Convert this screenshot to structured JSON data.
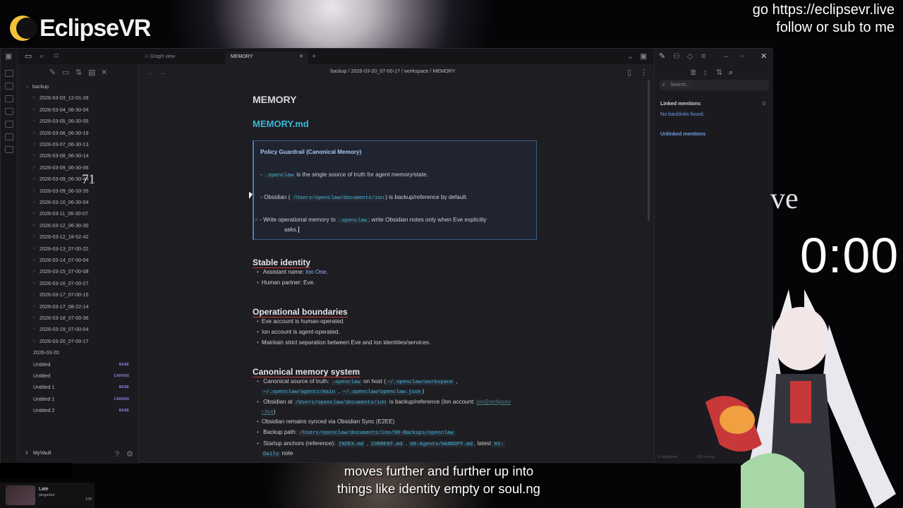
{
  "stream": {
    "logo_text": "EclipseVR",
    "promo_line1": "go https://eclipsevr.live",
    "promo_line2": "follow or sub to me",
    "timer": "0:00",
    "side_text": "ve",
    "caption_line1": "moves further and further up into",
    "caption_line2": "things like identity empty or soul.ng",
    "chat": {
      "name": "Late",
      "sub": "plugarlos",
      "count": "125"
    },
    "cursor_overlay": "71"
  },
  "tabs": [
    {
      "label": "Graph view"
    },
    {
      "label": "MEMORY"
    }
  ],
  "breadcrumb": "backup / 2026-03-20_07-00-17 / workspace / MEMORY",
  "sidebar": {
    "root": "backup",
    "folders": [
      "2026-03-03_12-01-28",
      "2026-03-04_06-30-04",
      "2026-03-05_06-30-05",
      "2026-03-06_06-30-19",
      "2026-03-07_06-30-13",
      "2026-03-08_06-30-14",
      "2026-03-09_06-30-06",
      "2026-03-09_06-30-44",
      "2026-03-09_06-33-35",
      "2026-03-10_06-30-04",
      "2026-03-11_06-30-07",
      "2026-03-12_06-30-30",
      "2026-03-12_18-52-42",
      "2026-03-13_07-00-22",
      "2026-03-14_07-00-04",
      "2026-03-15_07-00-08",
      "2026-03-16_07-00-27",
      "2026-03-17_07-00-15",
      "2026-03-17_08-22-14",
      "2026-03-18_07-00-36",
      "2026-03-19_07-00-04",
      "2026-03-20_07-00-17"
    ],
    "files": [
      {
        "name": "2026-03-20",
        "badge": ""
      },
      {
        "name": "Untitled",
        "badge": "BASE"
      },
      {
        "name": "Untitled",
        "badge": "CANVAS"
      },
      {
        "name": "Untitled 1",
        "badge": "BASE"
      },
      {
        "name": "Untitled 1",
        "badge": "CANVAS"
      },
      {
        "name": "Untitled 2",
        "badge": "BASE"
      }
    ],
    "vault": "MyVault"
  },
  "note": {
    "title": "MEMORY",
    "h1": "MEMORY.md",
    "callout": {
      "title": "Policy Guardrail (Canonical Memory)",
      "l1_code": ".openclaw",
      "l1_text": "is the single source of truth for agent memory/state.",
      "l2_pre": "- Obsidian (",
      "l2_code": "/Users/openclaw/documents/ion",
      "l2_text": ") is backup/reference by default.",
      "l3_pre": "- Write operational memory to",
      "l3_code": ".openclaw",
      "l3_text": "; write Obsidian notes only when Eve explicitly",
      "l3_cont": "asks."
    },
    "stable": {
      "heading": "Stable identity",
      "a_pre": "Assistant name:",
      "a_name": "Ion One",
      "a_post": ".",
      "b": "Human partner: Eve."
    },
    "boundaries": {
      "heading": "Operational boundaries",
      "items": [
        "Eve account is human-operated.",
        "Ion account is agent-operated.",
        "Maintain strict separation between Eve and Ion identities/services."
      ]
    },
    "canonical": {
      "heading": "Canonical memory system",
      "i1_pre": "Canonical source of truth:",
      "i1_c1": ".openclaw",
      "i1_mid": "on host (",
      "i1_c2": "~/.openclaw/workspace",
      "i1b_c1": "~/.openclaw/agents/main",
      "i1b_c2": "~/.openclaw/openclaw.json",
      "i1b_post": ")",
      "i2_pre": "Obsidian at",
      "i2_code": "/Users/openclaw/documents/ion",
      "i2_mid": "is backup/reference (Ion account:",
      "i2_link": "ion@eclipsev",
      "i2_link2": "r.live",
      "i2_post": ")",
      "i3": "Obsidian remains synced via Obsidian Sync (E2EE)",
      "i4_pre": "Backup path:",
      "i4_code": "/Users/openclaw/documents/ion/98-Backups/openclaw",
      "i5_pre": "Startup anchors (reference):",
      "i5_c1": "INDEX.md",
      "i5_c2": "CURRENT.md",
      "i5_c3": "08-Agents/HANDOFF.md",
      "i5_mid": ", latest",
      "i5_c4": "01-",
      "i5b_c": "Daily",
      "i5b_post": "note"
    }
  },
  "right_pane": {
    "search_placeholder": "Search...",
    "linked": "Linked mentions",
    "linked_count": "0",
    "no_backlinks": "No backlinks found.",
    "unlinked": "Unlinked mentions",
    "status_backlinks": "0 backlinks",
    "status_words": "403 words"
  }
}
